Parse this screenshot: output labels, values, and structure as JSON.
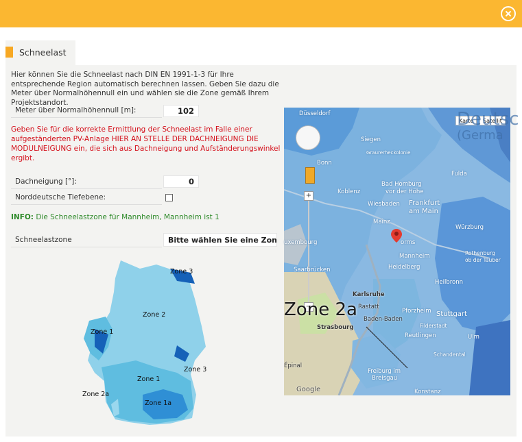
{
  "tab": {
    "label": "Schneelast"
  },
  "intro": "Hier können Sie die Schneelast nach DIN EN 1991-1-3 für Ihre entsprechende Region automatisch berechnen lassen. Geben Sie dazu die Meter über Normalhöhennull ein und wählen sie die Zone gemäß Ihrem Projektstandort.",
  "fields": {
    "altitude": {
      "label": "Meter über Normalhöhennull [m]:",
      "value": "102"
    },
    "roof_pitch": {
      "label": "Dachneigung [°]:",
      "value": "0"
    },
    "north_lowland": {
      "label": "Norddeutsche Tiefebene:",
      "checked": false
    },
    "snow_zone": {
      "label": "Schneelastzone",
      "value": "Bitte wählen Sie eine Zone a"
    }
  },
  "warning": "Geben Sie für die korrekte Ermittlung der Schneelast im Falle einer aufgeständerten PV-Anlage HIER AN STELLE DER DACHNEIGUNG DIE MODULNEIGUNG ein, die sich aus Dachneigung und Aufständerungswinkel ergibt.",
  "info": {
    "prefix": "INFO:",
    "text": "Die Schneelastzone für Mannheim, Mannheim ist 1"
  },
  "zone_map": {
    "labels": {
      "zone3_top": "Zone 3",
      "zone2": "Zone 2",
      "zone1_west": "Zone 1",
      "zone3_east": "Zone 3",
      "zone1_south": "Zone 1",
      "zone2a": "Zone 2a",
      "zone1a": "Zone 1a"
    },
    "colors": {
      "zone1": "#5fbde0",
      "zone1a": "#2f8fd5",
      "zone2": "#8fd1ea",
      "zone3": "#1561b8"
    }
  },
  "map": {
    "maptype": {
      "karte": "Karte",
      "satellite": "Satellit"
    },
    "overlay": {
      "deutsch": "Deutsc",
      "germa": "(Germa"
    },
    "big_zone_label": "Zone 2a",
    "zoom": {
      "plus": "+",
      "minus": "−"
    },
    "google": "Google",
    "places": {
      "duesseldorf": "Düsseldorf",
      "siegen": "Siegen",
      "grauerheck": "Graurerheckolonie",
      "bonn": "Bonn",
      "fulda": "Fulda",
      "badhomburg": "Bad Homburg",
      "vorderhoehe": "vor der Höhe",
      "koblenz": "Koblenz",
      "wiesbaden": "Wiesbaden",
      "frankfurt": "Frankfurt",
      "ammain": "am Main",
      "mainz": "Mainz",
      "wuerzburg": "Würzburg",
      "luxembourg": "uxembourg",
      "rothenburg": "Rothenburg",
      "obdertauber": "ob der Tauber",
      "saarbruecken": "Saarbrücken",
      "mannheim": "Mannheim",
      "worms": "orms",
      "heidelberg": "Heidelberg",
      "heilbronn": "Heilbronn",
      "karlsruhe": "Karlsruhe",
      "rastatt": "Rastatt",
      "pforzheim": "Pforzheim",
      "stuttgart": "Stuttgart",
      "badenbaden": "Baden-Baden",
      "strasbourg": "Strasbourg",
      "filderstadt": "Filderstadt",
      "reutlingen": "Reutlingen",
      "ulm": "Ulm",
      "schandental": "Schandental",
      "epinal": "Épinal",
      "freiburg": "Freiburg im",
      "breisgau": "Breisgau",
      "konstanz": "Konstanz"
    }
  }
}
